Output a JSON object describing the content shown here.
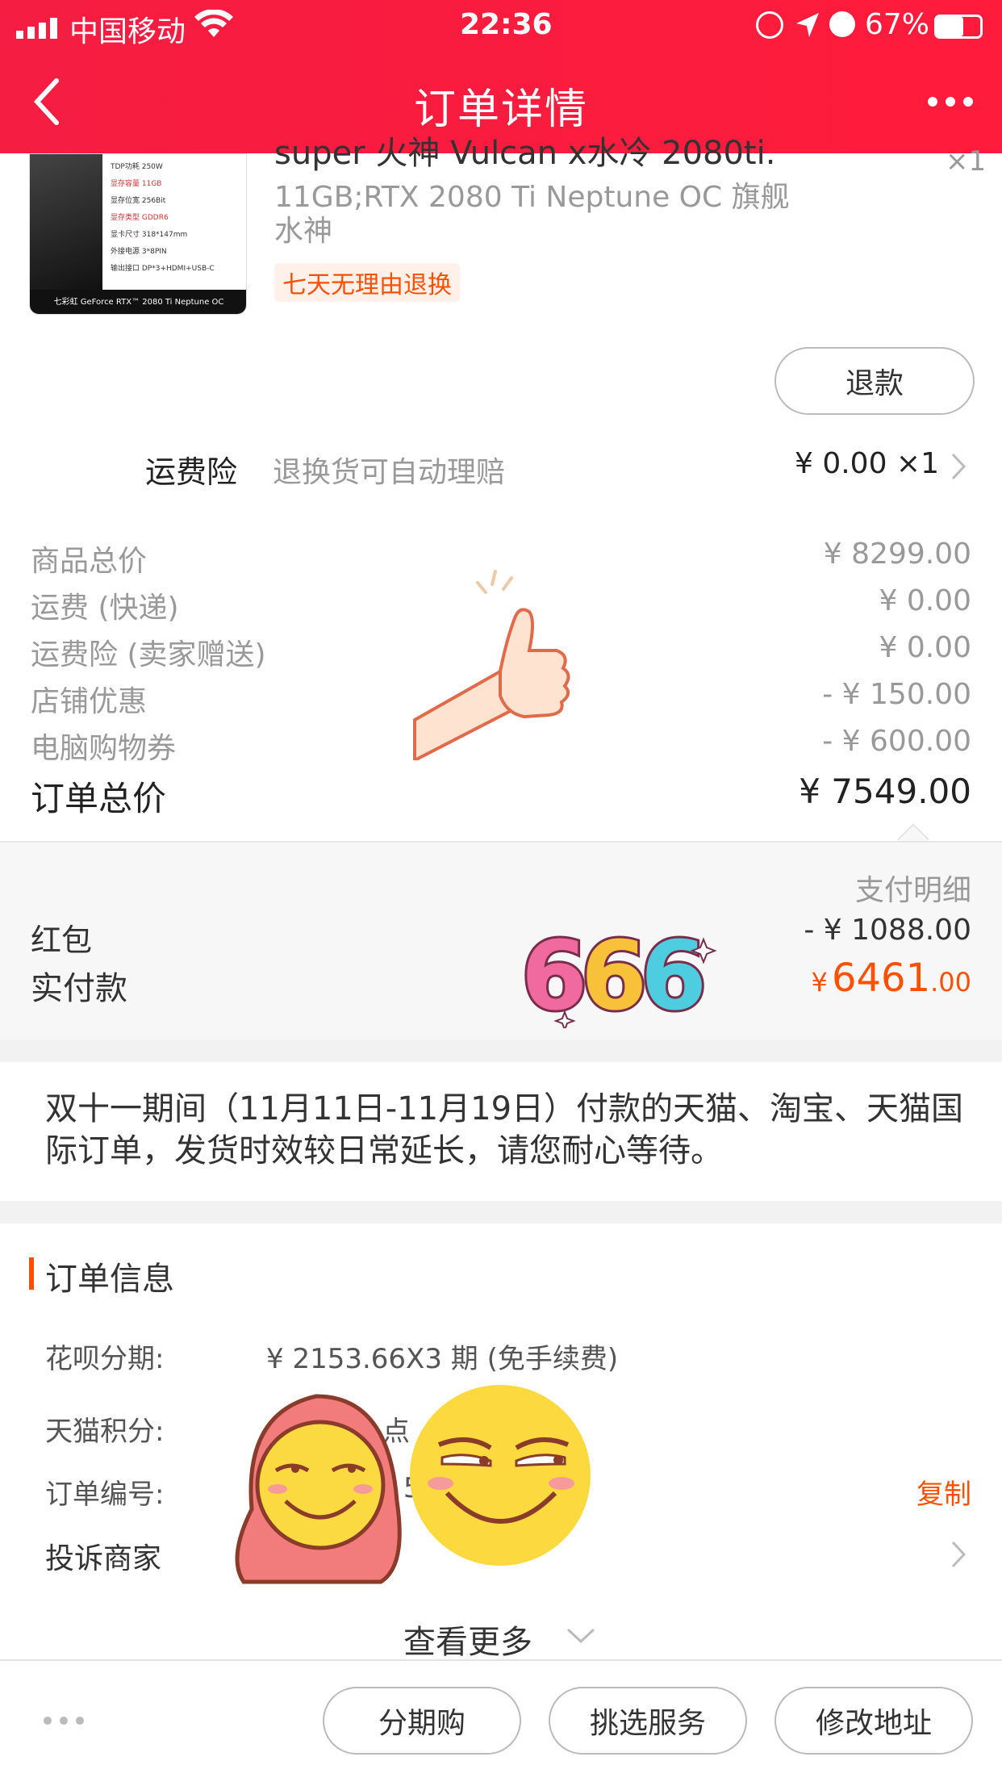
{
  "status_bar": {
    "carrier": "中国移动",
    "time": "22:36",
    "battery": "67%"
  },
  "header": {
    "title": "订单详情"
  },
  "product": {
    "title_partial": "super 火神 Vulcan x水冷 2080ti...",
    "qty": "×1",
    "sku": "11GB;RTX 2080 Ti Neptune OC 旗舰水神",
    "tag": "七天无理由退换",
    "refund_label": "退款",
    "image_caption": "七彩虹 GeForce RTX™ 2080 Ti Neptune OC",
    "image_specs": [
      "TDP功耗 250W",
      "显存容量 11GB",
      "显存位宽 256Bit",
      "显存类型 GDDR6",
      "显卡尺寸 318*147mm",
      "外接电源 3*8PIN",
      "输出接口 DP*3+HDMI+USB-C"
    ]
  },
  "insurance": {
    "label": "运费险",
    "desc": "退换货可自动理赔",
    "value": "¥ 0.00 ×1"
  },
  "price_rows": [
    {
      "label": "商品总价",
      "value": "¥ 8299.00"
    },
    {
      "label": "运费 (快递)",
      "value": "¥ 0.00"
    },
    {
      "label": "运费险 (卖家赠送)",
      "value": "¥ 0.00"
    },
    {
      "label": "店铺优惠",
      "value": "- ¥ 150.00"
    },
    {
      "label": "电脑购物券",
      "value": "- ¥ 600.00"
    }
  ],
  "total": {
    "label": "订单总价",
    "value": "¥ 7549.00"
  },
  "payment": {
    "detail_link": "支付明细",
    "redpacket_label": "红包",
    "redpacket_value": "- ¥ 1088.00",
    "paid_label": "实付款",
    "paid_symbol": "¥",
    "paid_int": "6461",
    "paid_dec": ".00",
    "paid_color": "#ff5000"
  },
  "sticker_text": "666",
  "notice": "双十一期间（11月11日-11月19日）付款的天猫、淘宝、天猫国际订单，发货时效较日常延长，请您耐心等待。",
  "order_info": {
    "section_title": "订单信息",
    "installment_label": "花呗分期:",
    "installment_value": "¥ 2153.66X3 期 (免手续费)",
    "points_label": "天猫积分:",
    "points_value_partial": "点",
    "order_no_label": "订单编号:",
    "order_no_partial": "5",
    "copy_label": "复制",
    "complaint_label": "投诉商家",
    "more_label": "查看更多"
  },
  "bottom_bar": {
    "buttons": [
      "分期购",
      "挑选服务",
      "修改地址"
    ]
  },
  "colors": {
    "brand": "#f51d42",
    "accent": "#ff5000",
    "section_bar": "#ff5000"
  }
}
